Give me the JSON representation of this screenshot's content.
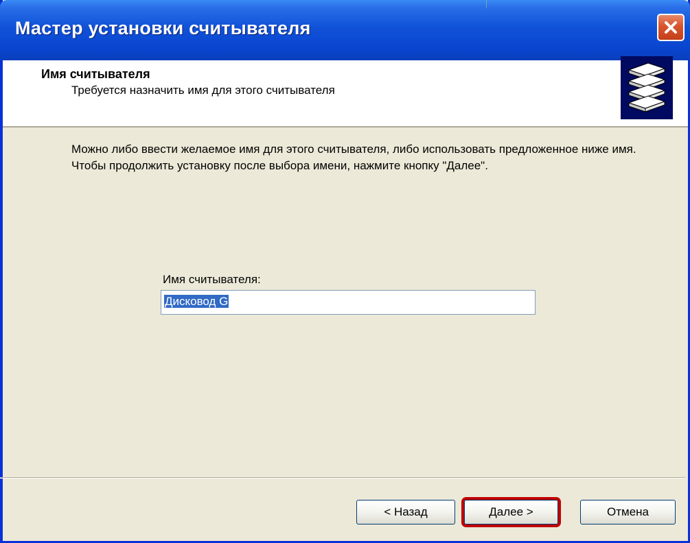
{
  "window": {
    "title": "Мастер установки считывателя"
  },
  "header": {
    "title": "Имя считывателя",
    "subtitle": "Требуется назначить имя для этого считывателя",
    "icon": "card-reader-icon"
  },
  "body": {
    "description": "Можно либо ввести желаемое имя для этого считывателя, либо использовать предложенное ниже имя. Чтобы продолжить установку после выбора имени, нажмите кнопку \"Далее\".",
    "field_label": "Имя считывателя:",
    "field_value": "Дисковод G"
  },
  "buttons": {
    "back": "< Назад",
    "next": "Далее >",
    "cancel": "Отмена"
  },
  "colors": {
    "titlebar": "#0a45cf",
    "close": "#d8542c",
    "highlight_border": "#c00000",
    "selection": "#316ac5"
  }
}
